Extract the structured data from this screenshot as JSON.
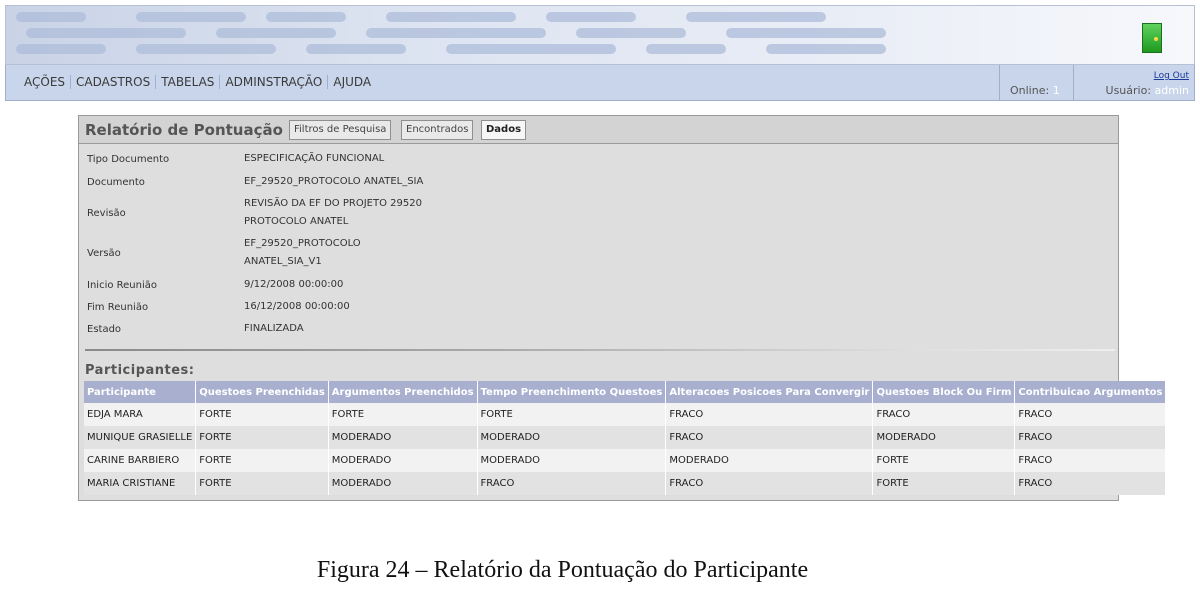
{
  "menu": {
    "items": [
      "AÇÕES",
      "CADASTROS",
      "TABELAS",
      "ADMINSTRAÇÃO",
      "AJUDA"
    ],
    "online_label": "Online:",
    "online_count": "1",
    "logout": "Log Out",
    "user_label": "Usuário:",
    "user_name": "admin"
  },
  "report": {
    "title": "Relatório de Pontuação",
    "tabs": [
      {
        "label": "Filtros de Pesquisa",
        "active": false
      },
      {
        "label": "Encontrados",
        "active": false
      },
      {
        "label": "Dados",
        "active": true
      }
    ],
    "fields": [
      {
        "label": "Tipo Documento",
        "value": "ESPECIFICAÇÃO FUNCIONAL"
      },
      {
        "label": "Documento",
        "value": "EF_29520_PROTOCOLO ANATEL_SIA"
      },
      {
        "label": "Revisão",
        "value": "REVISÃO DA EF DO PROJETO 29520",
        "value2": "PROTOCOLO ANATEL"
      },
      {
        "label": "Versão",
        "value": "EF_29520_PROTOCOLO",
        "value2": "ANATEL_SIA_V1"
      },
      {
        "label": "Inicio Reunião",
        "value": "9/12/2008 00:00:00"
      },
      {
        "label": "Fim Reunião",
        "value": "16/12/2008 00:00:00"
      },
      {
        "label": "Estado",
        "value": "FINALIZADA"
      }
    ],
    "participants_title": "Participantes:",
    "columns": [
      "Participante",
      "Questoes Preenchidas",
      "Argumentos Preenchidos",
      "Tempo Preenchimento Questoes",
      "Alteracoes Posicoes Para Convergir",
      "Questoes Block Ou Firm",
      "Contribuicao Argumentos"
    ],
    "rows": [
      [
        "EDJA MARA",
        "FORTE",
        "FORTE",
        "FORTE",
        "FRACO",
        "FRACO",
        "FRACO"
      ],
      [
        "MUNIQUE GRASIELLE",
        "FORTE",
        "MODERADO",
        "MODERADO",
        "FRACO",
        "MODERADO",
        "FRACO"
      ],
      [
        "CARINE BARBIERO",
        "FORTE",
        "MODERADO",
        "MODERADO",
        "MODERADO",
        "FORTE",
        "FRACO"
      ],
      [
        "MARIA CRISTIANE",
        "FORTE",
        "MODERADO",
        "FRACO",
        "FRACO",
        "FORTE",
        "FRACO"
      ]
    ]
  },
  "caption": "Figura 24 – Relatório da Pontuação do Participante",
  "colors": {
    "menu_bg": "#c9d5ea",
    "table_header": "#a9afcf",
    "panel_bg": "#dedede"
  },
  "icons": {
    "exit": "door-icon"
  }
}
